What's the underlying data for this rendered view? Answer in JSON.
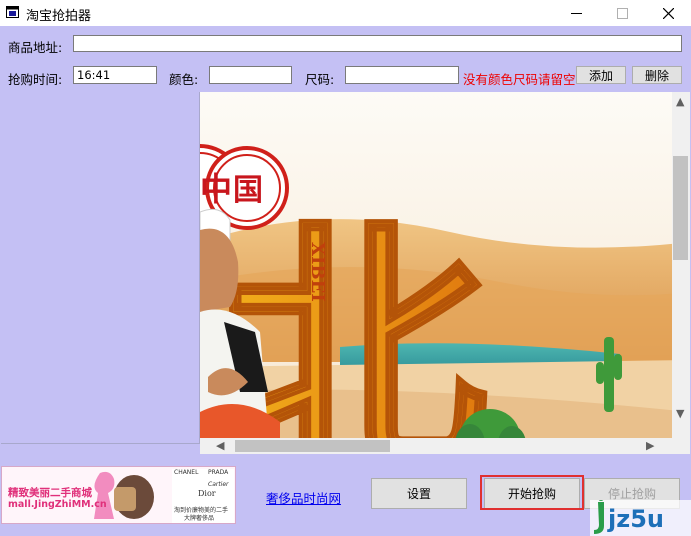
{
  "window": {
    "title": "淘宝抢拍器"
  },
  "form": {
    "url_label": "商品地址:",
    "url_value": "",
    "time_label": "抢购时间:",
    "time_value": "16:41",
    "color_label": "颜色:",
    "color_value": "",
    "size_label": "尺码:",
    "size_value": "",
    "warning": "没有颜色尺码请留空",
    "add_label": "添加",
    "delete_label": "删除"
  },
  "banner": {
    "big_char_1": "中",
    "big_char_2": "国",
    "big_char_3": "北",
    "vertical_text": "XIBEI"
  },
  "ad": {
    "line1": "精致美丽二手商城",
    "line2": "mall.JingZhiMM.cn",
    "brand1": "CHANEL",
    "brand2": "PRADA",
    "brand3": "Dior",
    "brand4": "Cartier",
    "tagline1": "淘到价廉物美的二手",
    "tagline2": "大牌奢侈品"
  },
  "footer": {
    "link_label": "奢侈品时尚网",
    "settings_label": "设置",
    "start_label": "开始抢购",
    "stop_label": "停止抢购"
  },
  "logo": {
    "text": "jz5u"
  },
  "colors": {
    "window_bg": "#c4c0f4",
    "warning": "#ee0000",
    "link": "#0000ee",
    "highlight": "#e03030"
  }
}
